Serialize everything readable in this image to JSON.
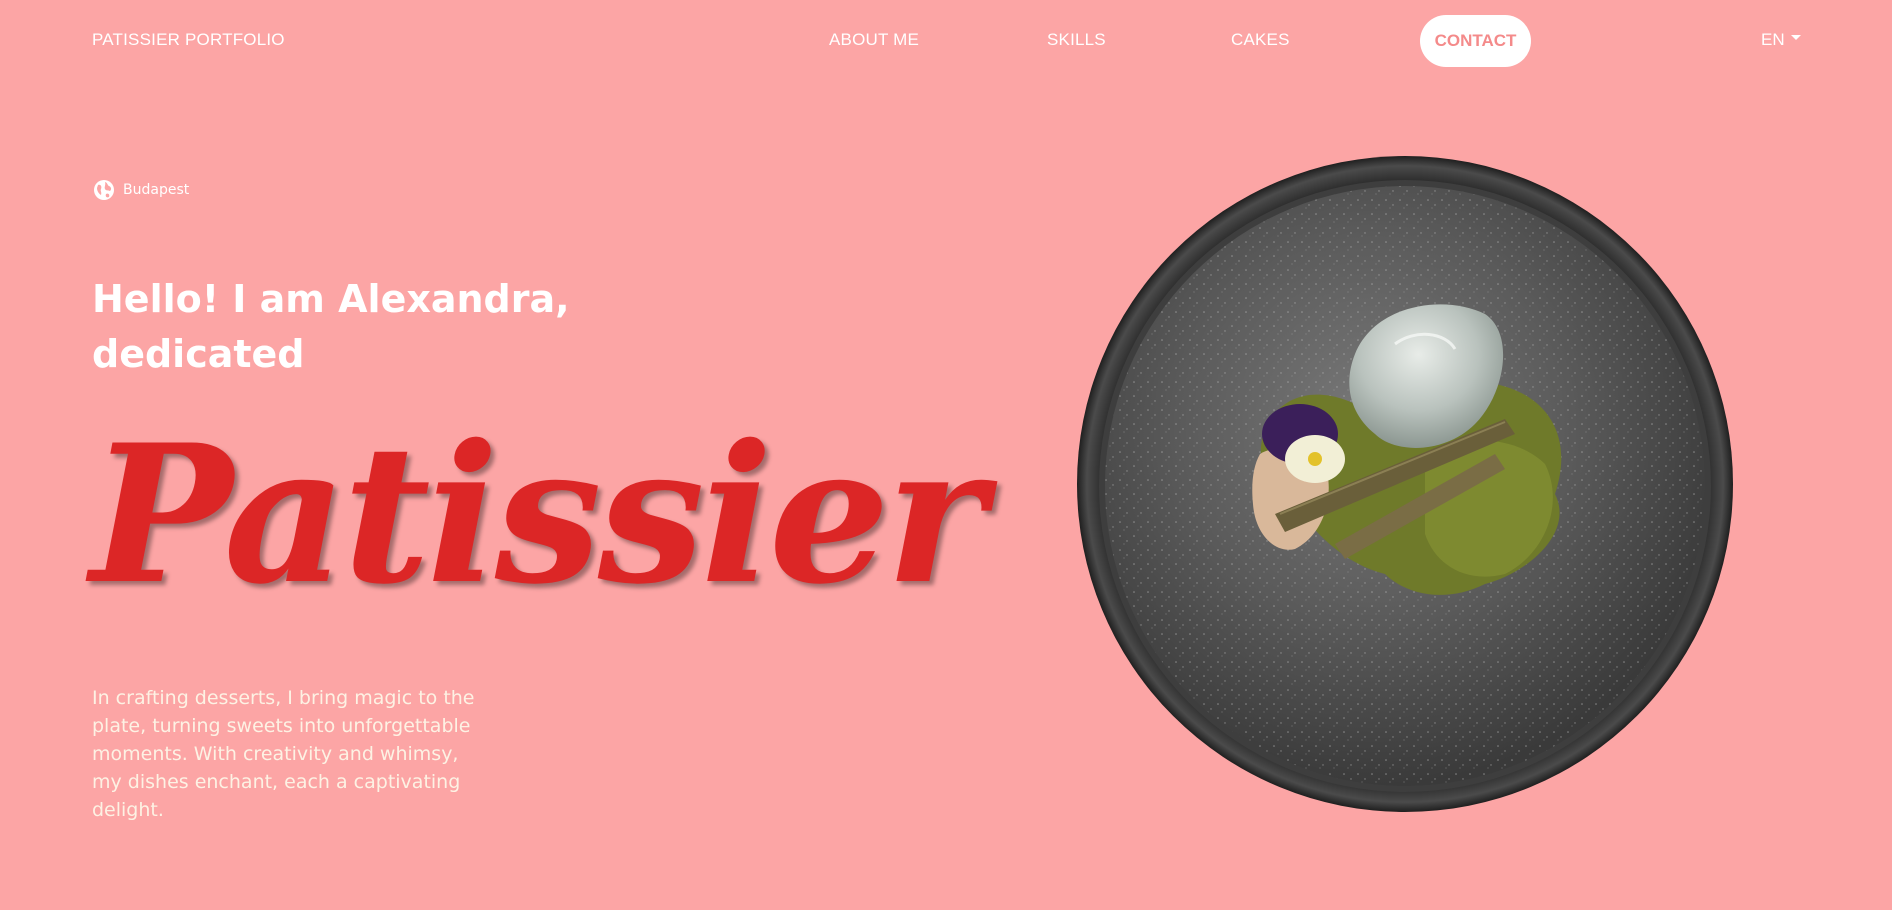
{
  "nav": {
    "brand": "PATISSIER PORTFOLIO",
    "links": [
      {
        "label": "ABOUT ME"
      },
      {
        "label": "SKILLS"
      },
      {
        "label": "CAKES"
      }
    ],
    "contact_label": "CONTACT",
    "language": "EN"
  },
  "hero": {
    "location": "Budapest",
    "greeting": "Hello! I am Alexandra, dedicated",
    "title": "Patissier",
    "intro": "In crafting desserts, I bring magic to the plate, turning sweets into unforgettable moments. With creativity and whimsy, my dishes enchant, each a captivating delight.",
    "icon": "globe-icon",
    "image": "dessert-plate-image"
  },
  "colors": {
    "background": "#FCA5A5",
    "accent": "#DC2626",
    "contact_text": "#F48A8A"
  }
}
